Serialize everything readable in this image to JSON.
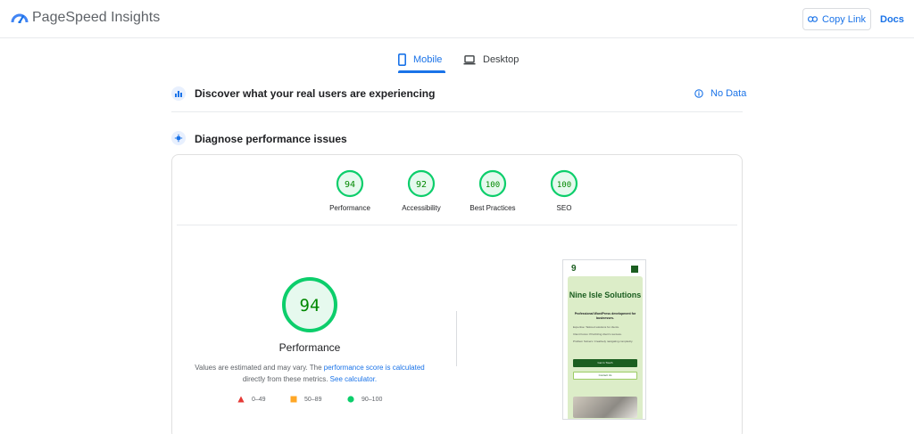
{
  "header": {
    "brand": "PageSpeed Insights",
    "copy_link": "Copy Link",
    "docs": "Docs",
    "accent": "#1a73e8"
  },
  "tabs": [
    {
      "label": "Mobile",
      "icon": "phone-icon",
      "active": true
    },
    {
      "label": "Desktop",
      "icon": "laptop-icon",
      "active": false
    }
  ],
  "field_section": {
    "title": "Discover what your real users are experiencing",
    "status": "No Data",
    "status_icon": "info-icon"
  },
  "lab_section": {
    "title": "Diagnose performance issues"
  },
  "scores": [
    {
      "label": "Performance",
      "value": "94"
    },
    {
      "label": "Accessibility",
      "value": "92"
    },
    {
      "label": "Best Practices",
      "value": "100"
    },
    {
      "label": "SEO",
      "value": "100"
    }
  ],
  "main_score": {
    "value": "94",
    "label": "Performance",
    "note_1": "Values are estimated and may vary. The ",
    "note_link_1": "performance score is calculated",
    "note_2": " directly from these metrics. ",
    "note_link_2": "See calculator."
  },
  "legend": [
    {
      "range": "0–49",
      "color": "#e53935",
      "shape": "triangle"
    },
    {
      "range": "50–89",
      "color": "#ffa726",
      "shape": "square"
    },
    {
      "range": "90–100",
      "color": "#0cce6b",
      "shape": "circle"
    }
  ],
  "preview": {
    "logo": "9",
    "title": "Nine Isle Solutions",
    "subtitle": "Professional WordPress development for businesses.",
    "line1": "Expertise: Tailored solutions for clients.",
    "line2": "Client Focus: Prioritizing client's success.",
    "line3": "Problem Solvers: Creatively navigating complexity.",
    "cta_primary": "Get In Touch",
    "cta_secondary": "Contact Us"
  },
  "colors": {
    "pass": "#0cce6b",
    "pass_text": "#008800",
    "pass_bg": "#e6f9ee"
  }
}
